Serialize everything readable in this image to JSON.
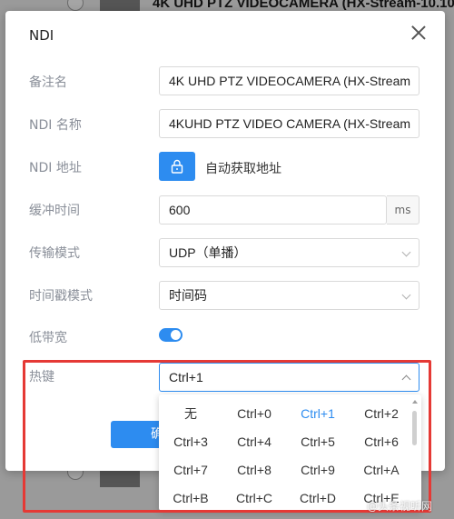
{
  "background": {
    "list_title": "4K UHD PTZ VIDEOCAMERA (HX-Stream-10.10..."
  },
  "dialog": {
    "title": "NDI",
    "fields": {
      "remark": {
        "label": "备注名",
        "value": "4K UHD PTZ VIDEOCAMERA (HX-Stream"
      },
      "ndi_name": {
        "label": "NDI 名称",
        "value": "4KUHD PTZ VIDEO CAMERA (HX-Stream"
      },
      "ndi_address": {
        "label": "NDI 地址",
        "auto_label": "自动获取地址"
      },
      "buffer": {
        "label": "缓冲时间",
        "value": "600",
        "unit": "ms"
      },
      "transport": {
        "label": "传输模式",
        "value": "UDP（单播）"
      },
      "timestamp": {
        "label": "时间戳模式",
        "value": "时间码"
      },
      "low_bandwidth": {
        "label": "低带宽",
        "enabled": true
      },
      "hotkey": {
        "label": "热键",
        "value": "Ctrl+1"
      }
    },
    "confirm_label": "确定",
    "hotkey_options": [
      "无",
      "Ctrl+0",
      "Ctrl+1",
      "Ctrl+2",
      "Ctrl+3",
      "Ctrl+4",
      "Ctrl+5",
      "Ctrl+6",
      "Ctrl+7",
      "Ctrl+8",
      "Ctrl+9",
      "Ctrl+A",
      "Ctrl+B",
      "Ctrl+C",
      "Ctrl+D",
      "Ctrl+E"
    ],
    "hotkey_selected": "Ctrl+1"
  },
  "colors": {
    "accent": "#2d8cf0",
    "highlight": "#e53935"
  },
  "watermark": "@头条视听网"
}
